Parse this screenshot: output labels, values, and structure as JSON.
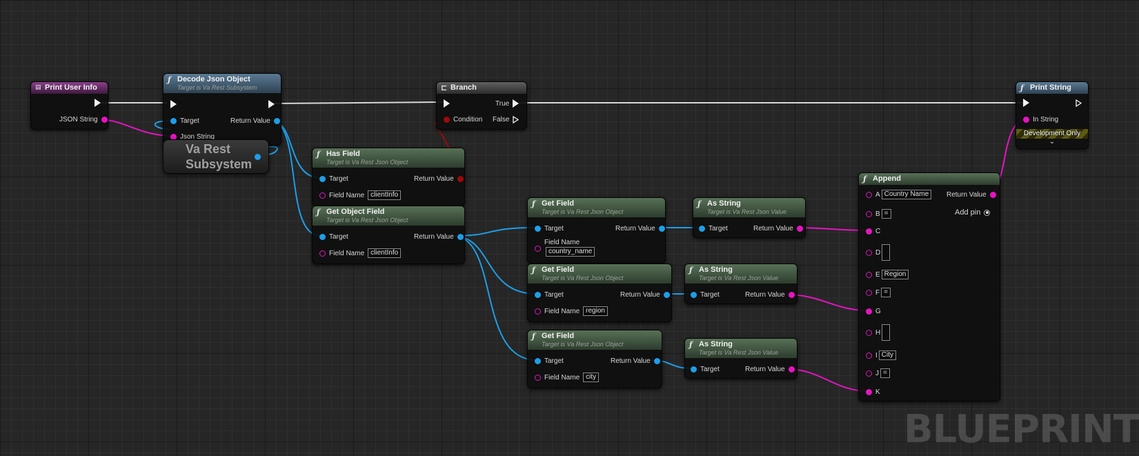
{
  "graph": {
    "watermark": "BLUEPRINT"
  },
  "nodes": {
    "print_user_info": {
      "title": "Print User Info",
      "json_string": "JSON String"
    },
    "decode_json": {
      "title": "Decode Json Object",
      "subtitle": "Target is Va Rest Subsystem",
      "target": "Target",
      "json_string": "Json String",
      "return_value": "Return Value"
    },
    "va_rest_subsystem": {
      "line1": "Va Rest",
      "line2": "Subsystem"
    },
    "branch": {
      "title": "Branch",
      "condition": "Condition",
      "true_label": "True",
      "false_label": "False"
    },
    "has_field": {
      "title": "Has Field",
      "subtitle": "Target is Va Rest Json Object",
      "target": "Target",
      "field_name": "Field Name",
      "field_value": "clientInfo",
      "return_value": "Return Value"
    },
    "get_object_field": {
      "title": "Get Object Field",
      "subtitle": "Target is Va Rest Json Object",
      "target": "Target",
      "field_name": "Field Name",
      "field_value": "clientInfo",
      "return_value": "Return Value"
    },
    "get_field_1": {
      "title": "Get Field",
      "subtitle": "Target is Va Rest Json Object",
      "target": "Target",
      "field_name": "Field Name",
      "field_value": "country_name",
      "return_value": "Return Value"
    },
    "get_field_2": {
      "title": "Get Field",
      "subtitle": "Target is Va Rest Json Object",
      "target": "Target",
      "field_name": "Field Name",
      "field_value": "region",
      "return_value": "Return Value"
    },
    "get_field_3": {
      "title": "Get Field",
      "subtitle": "Target is Va Rest Json Object",
      "target": "Target",
      "field_name": "Field Name",
      "field_value": "city",
      "return_value": "Return Value"
    },
    "as_string_1": {
      "title": "As String",
      "subtitle": "Target is Va Rest Json Value",
      "target": "Target",
      "return_value": "Return Value"
    },
    "as_string_2": {
      "title": "As String",
      "subtitle": "Target is Va Rest Json Value",
      "target": "Target",
      "return_value": "Return Value"
    },
    "as_string_3": {
      "title": "As String",
      "subtitle": "Target is Va Rest Json Value",
      "target": "Target",
      "return_value": "Return Value"
    },
    "append": {
      "title": "Append",
      "return_value": "Return Value",
      "add_pin": "Add pin",
      "pins": {
        "a": {
          "label": "A",
          "value": "Country Name"
        },
        "b": {
          "label": "B",
          "value": "="
        },
        "c": {
          "label": "C"
        },
        "d": {
          "label": "D"
        },
        "e": {
          "label": "E",
          "value": "Region"
        },
        "f": {
          "label": "F",
          "value": "="
        },
        "g": {
          "label": "G"
        },
        "h": {
          "label": "H"
        },
        "i": {
          "label": "I",
          "value": "City"
        },
        "j": {
          "label": "J",
          "value": "="
        },
        "k": {
          "label": "K"
        }
      }
    },
    "print_string": {
      "title": "Print String",
      "in_string": "In String",
      "dev_only": "Development Only",
      "expand": "⌄"
    }
  },
  "colors": {
    "exec_wire": "#d8d8d8",
    "object_wire": "#1e9ee8",
    "string_wire": "#e614c2",
    "bool_wire": "#9c0a0a"
  }
}
